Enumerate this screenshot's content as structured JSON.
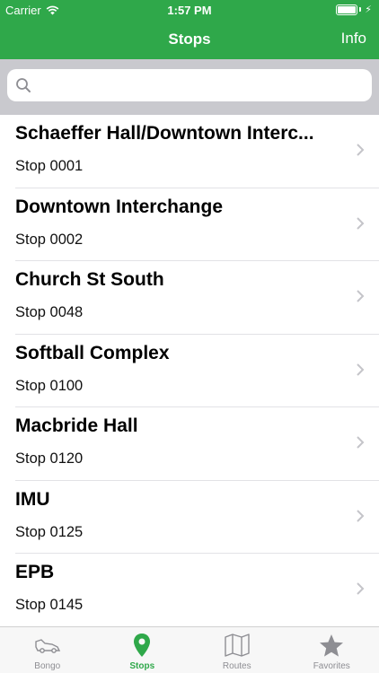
{
  "status_bar": {
    "carrier": "Carrier",
    "time": "1:57 PM"
  },
  "nav": {
    "title": "Stops",
    "right_button": "Info"
  },
  "search": {
    "placeholder": ""
  },
  "stops": [
    {
      "name": "Schaeffer Hall/Downtown Interc...",
      "stop": "Stop 0001"
    },
    {
      "name": "Downtown Interchange",
      "stop": "Stop 0002"
    },
    {
      "name": "Church St South",
      "stop": "Stop 0048"
    },
    {
      "name": "Softball Complex",
      "stop": "Stop 0100"
    },
    {
      "name": "Macbride Hall",
      "stop": "Stop 0120"
    },
    {
      "name": "IMU",
      "stop": "Stop 0125"
    },
    {
      "name": "EPB",
      "stop": "Stop 0145"
    }
  ],
  "tabs": [
    {
      "label": "Bongo",
      "icon": "bus-icon"
    },
    {
      "label": "Stops",
      "icon": "map-pin-icon"
    },
    {
      "label": "Routes",
      "icon": "map-icon"
    },
    {
      "label": "Favorites",
      "icon": "star-icon"
    }
  ],
  "colors": {
    "accent": "#2fa84a",
    "inactive": "#8e8e93"
  }
}
